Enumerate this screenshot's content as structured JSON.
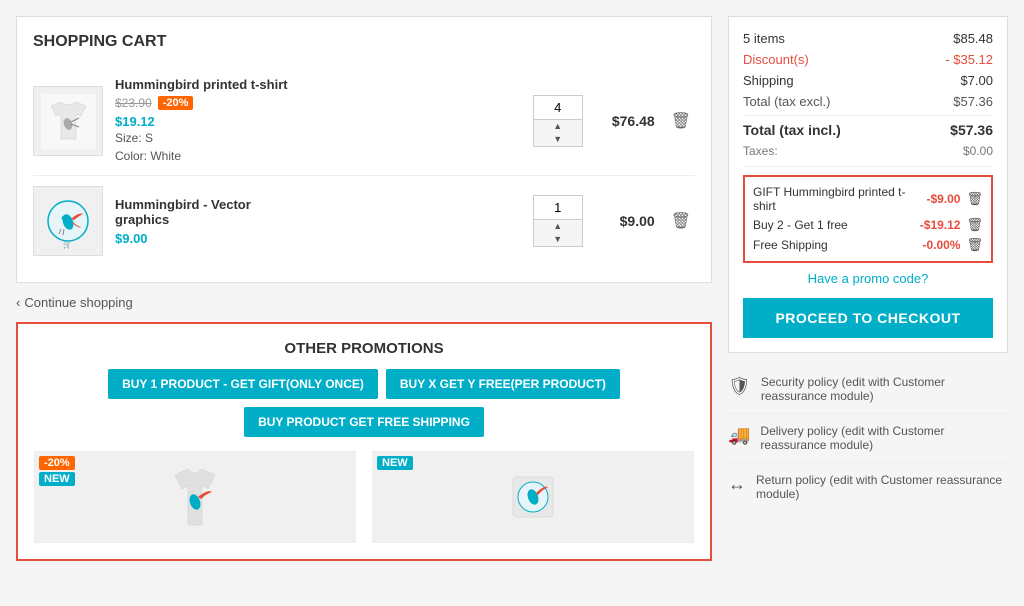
{
  "page": {
    "title": "Shopping Cart"
  },
  "cart": {
    "title": "SHOPPING CART",
    "items": [
      {
        "id": "item-1",
        "name": "Hummingbird printed t-shirt",
        "original_price": "$23.90",
        "discount_badge": "-20%",
        "sale_price": "$19.12",
        "quantity": 4,
        "total_price": "$76.48",
        "size": "S",
        "color": "White"
      },
      {
        "id": "item-2",
        "name": "Hummingbird - Vector graphics",
        "sale_price": "$9.00",
        "quantity": 1,
        "total_price": "$9.00"
      }
    ],
    "continue_shopping": "Continue shopping"
  },
  "promotions": {
    "title": "OTHER PROMOTIONS",
    "buttons": [
      "BUY 1 PRODUCT - GET GIFT(ONLY ONCE)",
      "BUY X GET Y FREE(PER PRODUCT)",
      "BUY PRODUCT GET FREE SHIPPING"
    ],
    "products": [
      {
        "badges": [
          "-20%",
          "NEW"
        ]
      },
      {
        "badges": [
          "NEW"
        ]
      }
    ]
  },
  "summary": {
    "items_count": "5 items",
    "items_price": "$85.48",
    "discount_label": "Discount(s)",
    "discount_value": "- $35.12",
    "shipping_label": "Shipping",
    "shipping_value": "$7.00",
    "total_excl_label": "Total (tax excl.)",
    "total_excl_value": "$57.36",
    "total_incl_label": "Total (tax incl.)",
    "total_incl_value": "$57.36",
    "taxes_label": "Taxes:",
    "taxes_value": "$0.00",
    "promotions_applied": [
      {
        "name": "GIFT Hummingbird printed t-shirt",
        "value": "-$9.00"
      },
      {
        "name": "Buy 2 - Get 1 free",
        "value": "-$19.12"
      },
      {
        "name": "Free Shipping",
        "value": "-0.00%"
      }
    ],
    "promo_code_label": "Have a promo code?",
    "checkout_button": "PROCEED TO CHECKOUT"
  },
  "reassurance": [
    {
      "icon": "shield",
      "text": "Security policy (edit with Customer reassurance module)"
    },
    {
      "icon": "truck",
      "text": "Delivery policy (edit with Customer reassurance module)"
    },
    {
      "icon": "return",
      "text": "Return policy (edit with Customer reassurance module)"
    }
  ]
}
